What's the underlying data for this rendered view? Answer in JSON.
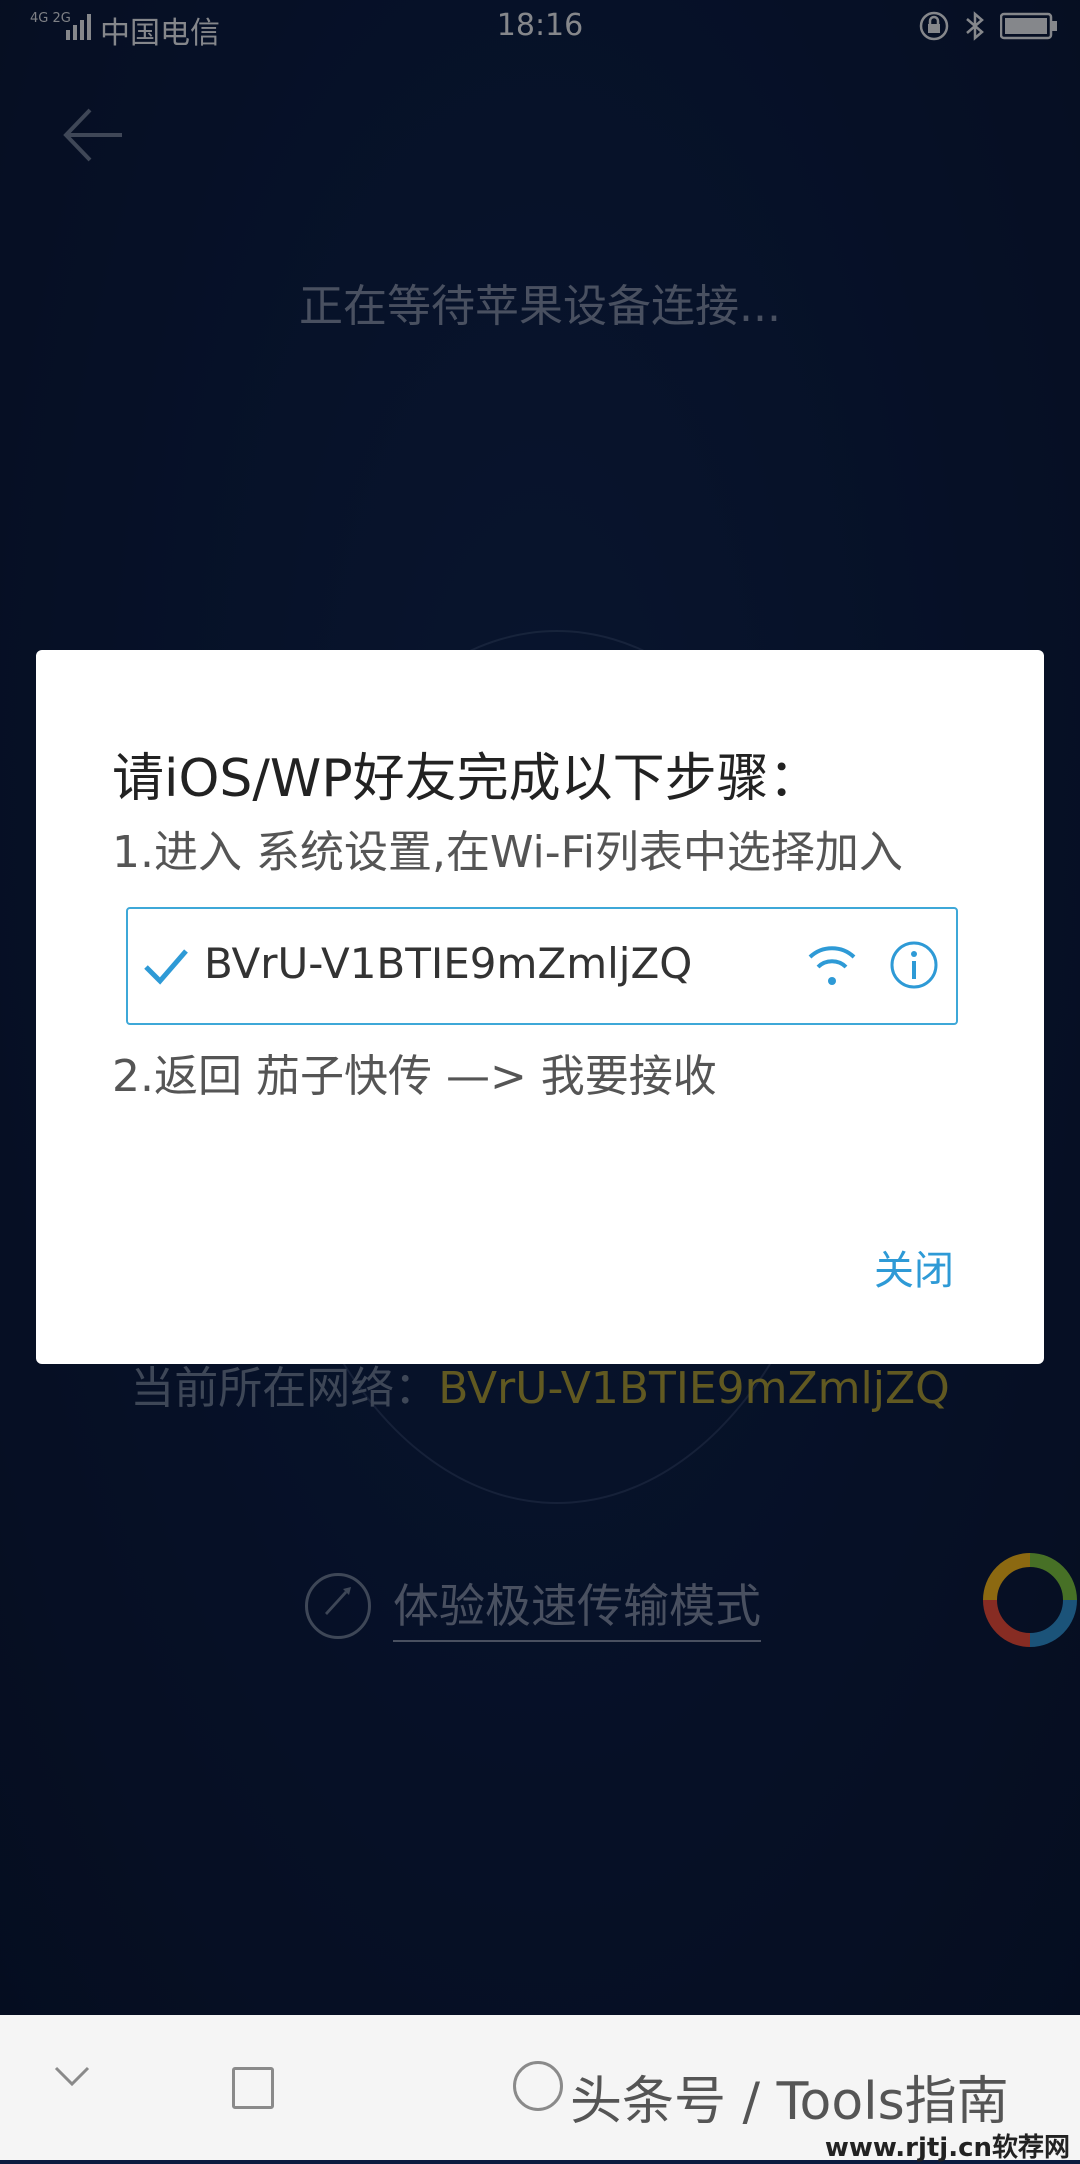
{
  "status_bar": {
    "network_type": "4G 2G",
    "carrier": "中国电信",
    "time": "18:16"
  },
  "background": {
    "waiting_text": "正在等待苹果设备连接...",
    "current_network_label": "当前所在网络：",
    "current_network_ssid": "BVrU-V1BTIE9mZmljZQ",
    "fast_mode_label": "体验极速传输模式"
  },
  "dialog": {
    "title": "请iOS/WP好友完成以下步骤：",
    "step1": "1.进入 系统设置,在Wi-Fi列表中选择加入",
    "wifi_ssid": "BVrU-V1BTIE9mZmljZQ",
    "step2": "2.返回 茄子快传 —> 我要接收",
    "close_label": "关闭"
  },
  "nav_bar": {
    "watermark": "头条号 / Tools指南",
    "watermark_site": "www.rjtj.cn软荐网"
  },
  "colors": {
    "accent": "#2e9ad6",
    "background": "#0c1d44",
    "ssid_highlight": "#a89a3a"
  }
}
